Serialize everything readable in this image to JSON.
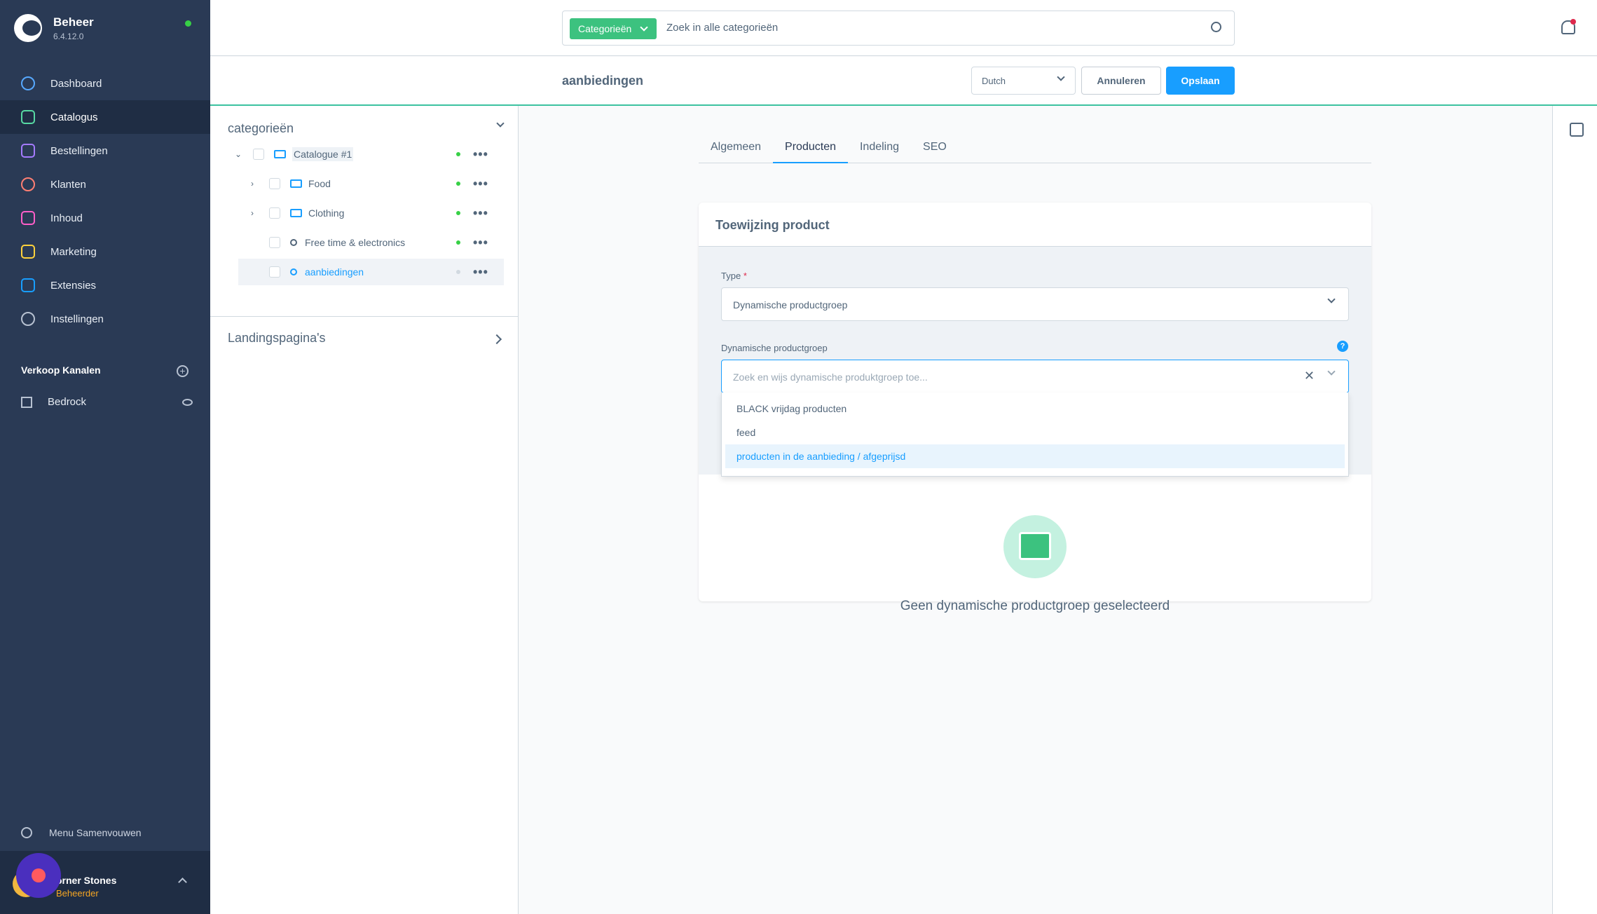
{
  "app": {
    "name": "Beheer",
    "version": "6.4.12.0"
  },
  "nav": {
    "items": [
      "Dashboard",
      "Catalogus",
      "Bestellingen",
      "Klanten",
      "Inhoud",
      "Marketing",
      "Extensies",
      "Instellingen"
    ],
    "sales_channels": "Verkoop Kanalen",
    "channel": "Bedrock",
    "collapse": "Menu Samenvouwen"
  },
  "user": {
    "name": "orner Stones",
    "role": "Beheerder"
  },
  "search": {
    "type": "Categorieën",
    "placeholder": "Zoek in alle categorieën"
  },
  "header": {
    "title": "aanbiedingen",
    "language": "Dutch",
    "cancel": "Annuleren",
    "save": "Opslaan"
  },
  "tree": {
    "title": "categorieën",
    "items": [
      "Catalogue #1",
      "Food",
      "Clothing",
      "Free time & electronics",
      "aanbiedingen"
    ],
    "landing": "Landingspagina's"
  },
  "tabs": [
    "Algemeen",
    "Producten",
    "Indeling",
    "SEO"
  ],
  "card": {
    "title": "Toewijzing product",
    "type_label": "Type",
    "required": "*",
    "type_value": "Dynamische productgroep",
    "group_label": "Dynamische productgroep",
    "group_placeholder": "Zoek en wijs dynamische produktgroep toe...",
    "help": "?",
    "options": [
      "BLACK vrijdag producten",
      "feed",
      "producten in de aanbieding / afgeprijsd"
    ],
    "empty": "Geen dynamische productgroep geselecteerd"
  },
  "colors": {
    "sidebar": "#2a3a55",
    "accent": "#189eff",
    "green": "#3cc27f"
  }
}
